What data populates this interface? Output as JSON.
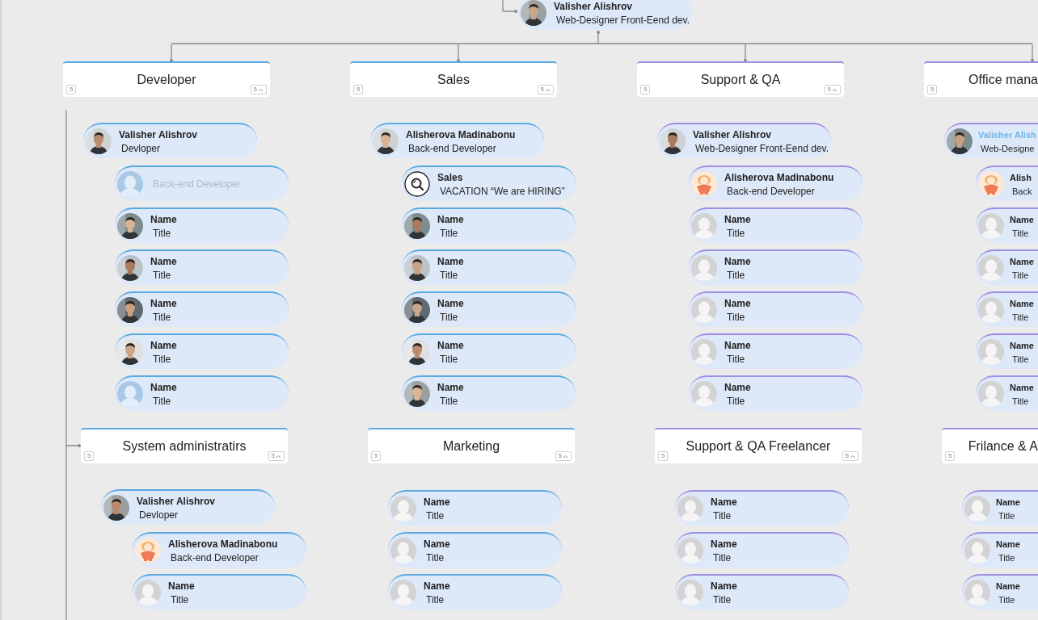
{
  "top": {
    "name": "Valisher Alishrov",
    "title": "Web-Designer Front-Eend dev."
  },
  "columns": [
    {
      "departments": [
        {
          "title": "Developer",
          "color": "#5aa9e2",
          "joined": true,
          "count": "5",
          "count_open": "5",
          "manager": {
            "name": "Valisher Alishrov",
            "title": "Devloper",
            "selected": false
          },
          "members": [
            {
              "kind": "draft",
              "title": "Back-end Developer"
            },
            {
              "name": "Name",
              "title": "Title"
            },
            {
              "name": "Name",
              "title": "Title"
            },
            {
              "name": "Name",
              "title": "Title"
            },
            {
              "name": "Name",
              "title": "Title"
            },
            {
              "kind": "blue-silhouette",
              "name": "Name",
              "title": "Title"
            }
          ]
        },
        {
          "title": "System administratirs",
          "color": "#5aa9e2",
          "joined": true,
          "count": "5",
          "count_open": "5",
          "manager": {
            "name": "Valisher Alishrov",
            "title": "Devloper",
            "selected": false
          },
          "members": [
            {
              "kind": "mascot",
              "name": "Alisherova Madinabonu",
              "title": "Back-end Developer"
            },
            {
              "kind": "silhouette",
              "name": "Name",
              "title": "Title"
            }
          ]
        }
      ]
    },
    {
      "departments": [
        {
          "title": "Sales",
          "color": "#5aa9e2",
          "joined": true,
          "count": "5",
          "count_open": "5",
          "manager": {
            "name": "Alisherova Madinabonu",
            "title": "Back-end Developer",
            "selected": false
          },
          "members": [
            {
              "kind": "vacancy",
              "name": "Sales",
              "title": "VACATION “We are HIRING”"
            },
            {
              "name": "Name",
              "title": "Title"
            },
            {
              "name": "Name",
              "title": "Title"
            },
            {
              "name": "Name",
              "title": "Title"
            },
            {
              "name": "Name",
              "title": "Title"
            },
            {
              "name": "Name",
              "title": "Title"
            }
          ]
        },
        {
          "title": "Marketing",
          "color": "#5aa9e2",
          "joined": false,
          "count": "5",
          "count_open": "5",
          "members": [
            {
              "kind": "silhouette",
              "name": "Name",
              "title": "Title"
            },
            {
              "kind": "silhouette",
              "name": "Name",
              "title": "Title"
            },
            {
              "kind": "silhouette",
              "name": "Name",
              "title": "Title"
            }
          ]
        }
      ]
    },
    {
      "departments": [
        {
          "title": "Support & QA",
          "color": "#9d8fe4",
          "joined": true,
          "count": "5",
          "count_open": "5",
          "manager": {
            "name": "Valisher Alishrov",
            "title": "Web-Designer Front-Eend dev.",
            "selected": false
          },
          "members": [
            {
              "kind": "mascot",
              "name": "Alisherova Madinabonu",
              "title": "Back-end Developer"
            },
            {
              "kind": "silhouette",
              "name": "Name",
              "title": "Title"
            },
            {
              "kind": "silhouette",
              "name": "Name",
              "title": "Title"
            },
            {
              "kind": "silhouette",
              "name": "Name",
              "title": "Title"
            },
            {
              "kind": "silhouette",
              "name": "Name",
              "title": "Title"
            },
            {
              "kind": "silhouette",
              "name": "Name",
              "title": "Title"
            }
          ]
        },
        {
          "title": "Support & QA Freelancer",
          "color": "#9d8fe4",
          "joined": false,
          "count": "5",
          "count_open": "5",
          "members": [
            {
              "kind": "silhouette",
              "name": "Name",
              "title": "Title"
            },
            {
              "kind": "silhouette",
              "name": "Name",
              "title": "Title"
            },
            {
              "kind": "silhouette",
              "name": "Name",
              "title": "Title"
            }
          ]
        }
      ]
    },
    {
      "departments": [
        {
          "title": "Office mana",
          "color": "#9d8fe4",
          "joined": true,
          "count": "5",
          "manager": {
            "name": "Valisher Alish",
            "title": "Web-Designe",
            "selected": true
          },
          "members": [
            {
              "kind": "mascot",
              "name": "Alish",
              "title": "Back"
            },
            {
              "kind": "silhouette",
              "name": "Name",
              "title": "Title"
            },
            {
              "kind": "silhouette",
              "name": "Name",
              "title": "Title"
            },
            {
              "kind": "silhouette",
              "name": "Name",
              "title": "Title"
            },
            {
              "kind": "silhouette",
              "name": "Name",
              "title": "Title"
            },
            {
              "kind": "silhouette",
              "name": "Name",
              "title": "Title"
            }
          ]
        },
        {
          "title": "Frilance & A",
          "color": "#9d8fe4",
          "joined": false,
          "count": "5",
          "members": [
            {
              "kind": "silhouette",
              "name": "Name",
              "title": "Title"
            },
            {
              "kind": "silhouette",
              "name": "Name",
              "title": "Title"
            },
            {
              "kind": "silhouette",
              "name": "Name",
              "title": "Title"
            }
          ]
        }
      ]
    }
  ]
}
